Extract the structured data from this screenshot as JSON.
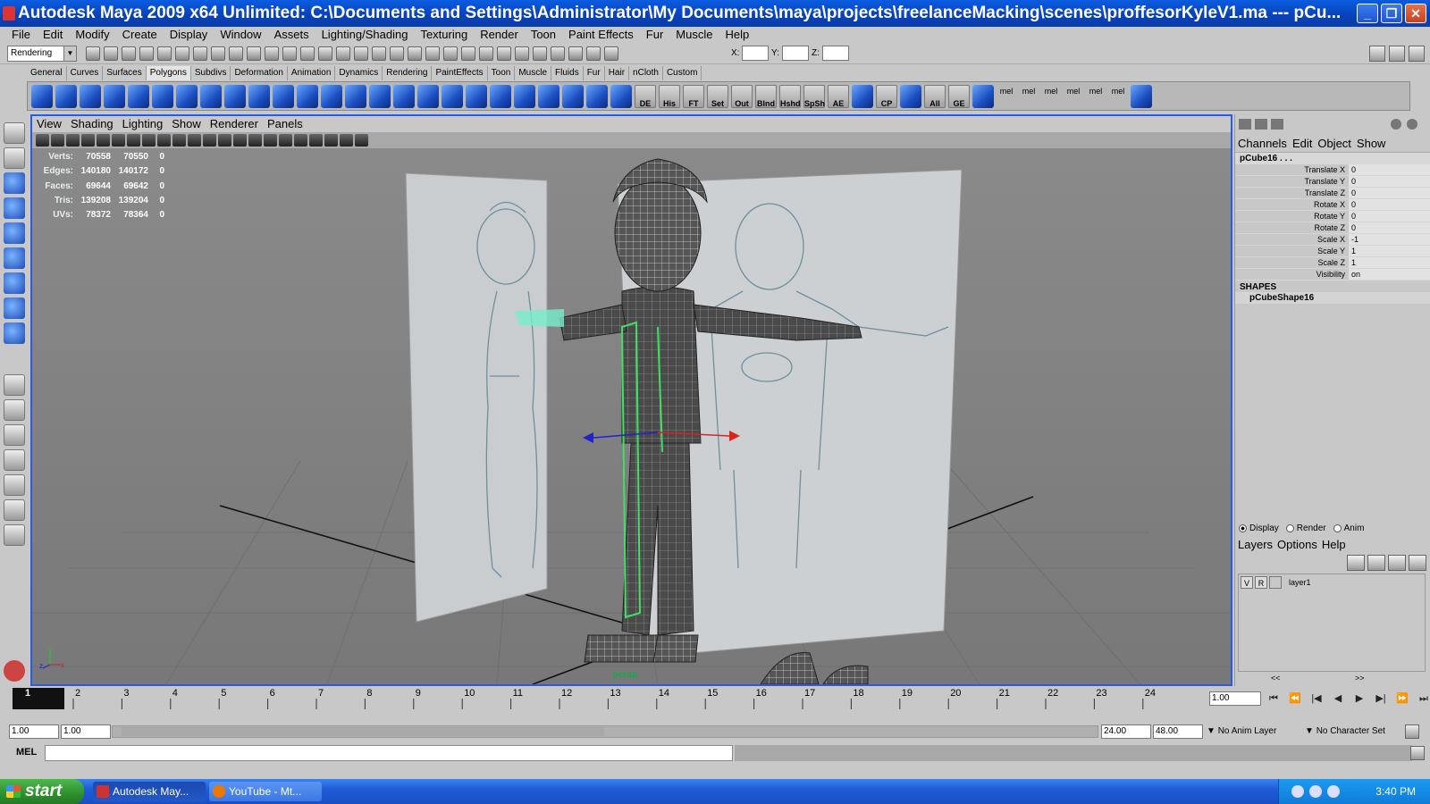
{
  "window": {
    "title": "Autodesk Maya 2009 x64 Unlimited: C:\\Documents and Settings\\Administrator\\My Documents\\maya\\projects\\freelanceMacking\\scenes\\proffesorKyleV1.ma  ---  pCu...",
    "minimize": "_",
    "maximize": "❐",
    "close": "✕"
  },
  "menu": [
    "File",
    "Edit",
    "Modify",
    "Create",
    "Display",
    "Window",
    "Assets",
    "Lighting/Shading",
    "Texturing",
    "Render",
    "Toon",
    "Paint Effects",
    "Fur",
    "Muscle",
    "Help"
  ],
  "status_line": {
    "mode": "Rendering",
    "x_label": "X:",
    "y_label": "Y:",
    "z_label": "Z:"
  },
  "shelf_tabs": [
    "General",
    "Curves",
    "Surfaces",
    "Polygons",
    "Subdivs",
    "Deformation",
    "Animation",
    "Dynamics",
    "Rendering",
    "PaintEffects",
    "Toon",
    "Muscle",
    "Fluids",
    "Fur",
    "Hair",
    "nCloth",
    "Custom"
  ],
  "active_shelf_tab": "Polygons",
  "shelf_labels": [
    "DE",
    "His",
    "FT",
    "Set",
    "Out",
    "Blnd",
    "Hshd",
    "SpSh",
    "AE",
    "CP",
    "All",
    "GE"
  ],
  "shelf_mel": [
    "mel",
    "mel",
    "mel",
    "mel",
    "mel",
    "mel"
  ],
  "viewport": {
    "menu": [
      "View",
      "Shading",
      "Lighting",
      "Show",
      "Renderer",
      "Panels"
    ],
    "camera": "persp",
    "hud": [
      {
        "label": "Verts:",
        "a": "70558",
        "b": "70550",
        "c": "0"
      },
      {
        "label": "Edges:",
        "a": "140180",
        "b": "140172",
        "c": "0"
      },
      {
        "label": "Faces:",
        "a": "69644",
        "b": "69642",
        "c": "0"
      },
      {
        "label": "Tris:",
        "a": "139208",
        "b": "139204",
        "c": "0"
      },
      {
        "label": "UVs:",
        "a": "78372",
        "b": "78364",
        "c": "0"
      }
    ],
    "axis": {
      "y": "y",
      "z": "z",
      "x": "x"
    }
  },
  "channel_box": {
    "menu": [
      "Channels",
      "Edit",
      "Object",
      "Show"
    ],
    "object": "pCube16 . . .",
    "attributes": [
      {
        "name": "Translate X",
        "value": "0"
      },
      {
        "name": "Translate Y",
        "value": "0"
      },
      {
        "name": "Translate Z",
        "value": "0"
      },
      {
        "name": "Rotate X",
        "value": "0"
      },
      {
        "name": "Rotate Y",
        "value": "0"
      },
      {
        "name": "Rotate Z",
        "value": "0"
      },
      {
        "name": "Scale X",
        "value": "-1"
      },
      {
        "name": "Scale Y",
        "value": "1"
      },
      {
        "name": "Scale Z",
        "value": "1"
      },
      {
        "name": "Visibility",
        "value": "on"
      }
    ],
    "shapes_header": "SHAPES",
    "shape": "pCubeShape16"
  },
  "layers": {
    "radios": [
      "Display",
      "Render",
      "Anim"
    ],
    "menu": [
      "Layers",
      "Options",
      "Help"
    ],
    "row": {
      "v": "V",
      "r": "R",
      "name": "layer1"
    },
    "scroll_left": "<<",
    "scroll_right": ">>"
  },
  "timeline": {
    "current_frame": "1",
    "ticks": [
      "2",
      "3",
      "4",
      "5",
      "6",
      "7",
      "8",
      "9",
      "10",
      "11",
      "12",
      "13",
      "14",
      "15",
      "16",
      "17",
      "18",
      "19",
      "20",
      "21",
      "22",
      "23",
      "24"
    ],
    "current_time_field": "1.00",
    "range_start": "1.00",
    "playback_start": "1.00",
    "playback_end": "24.00",
    "range_end": "48.00",
    "anim_layer": "No Anim Layer",
    "character_set": "No Character Set"
  },
  "command_line": {
    "label": "MEL"
  },
  "taskbar": {
    "start": "start",
    "tasks": [
      "Autodesk May...",
      "YouTube - Mt..."
    ],
    "clock": "3:40 PM"
  }
}
